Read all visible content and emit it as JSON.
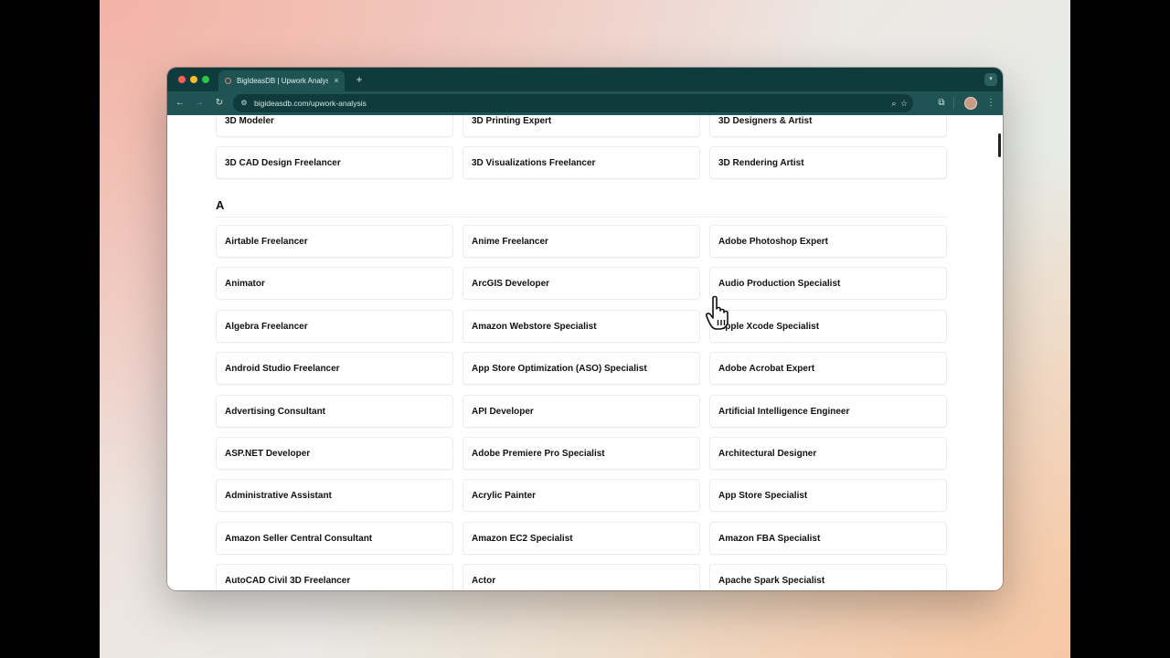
{
  "browser": {
    "tab_title": "BigIdeasDB | Upwork Analysis",
    "tab_close": "×",
    "new_tab": "+",
    "tab_menu_icon": "chevron-down-icon",
    "url": "bigideasdb.com/upwork-analysis",
    "nav_icons": [
      "back-arrow-icon",
      "forward-arrow-icon",
      "reload-icon"
    ],
    "toolbar_icons": [
      "site-settings-icon",
      "zoom-icon",
      "bookmark-star-icon",
      "extensions-icon",
      "profile-avatar",
      "more-menu-icon"
    ],
    "accent_color": "#1f5354"
  },
  "page": {
    "top_partial_row": [
      "3D Modeler",
      "3D Printing Expert",
      "3D Designers & Artist"
    ],
    "row_3d": [
      "3D CAD Design Freelancer",
      "3D Visualizations Freelancer",
      "3D Rendering Artist"
    ],
    "section_letter": "A",
    "a_items": [
      "Airtable Freelancer",
      "Anime Freelancer",
      "Adobe Photoshop Expert",
      "Animator",
      "ArcGIS Developer",
      "Audio Production Specialist",
      "Algebra Freelancer",
      "Amazon Webstore Specialist",
      "Apple Xcode Specialist",
      "Android Studio Freelancer",
      "App Store Optimization (ASO) Specialist",
      "Adobe Acrobat Expert",
      "Advertising Consultant",
      "API Developer",
      "Artificial Intelligence Engineer",
      "ASP.NET Developer",
      "Adobe Premiere Pro Specialist",
      "Architectural Designer",
      "Administrative Assistant",
      "Acrylic Painter",
      "App Store Specialist",
      "Amazon Seller Central Consultant",
      "Amazon EC2 Specialist",
      "Amazon FBA Specialist",
      "AutoCAD Civil 3D Freelancer",
      "Actor",
      "Apache Spark Specialist"
    ]
  }
}
